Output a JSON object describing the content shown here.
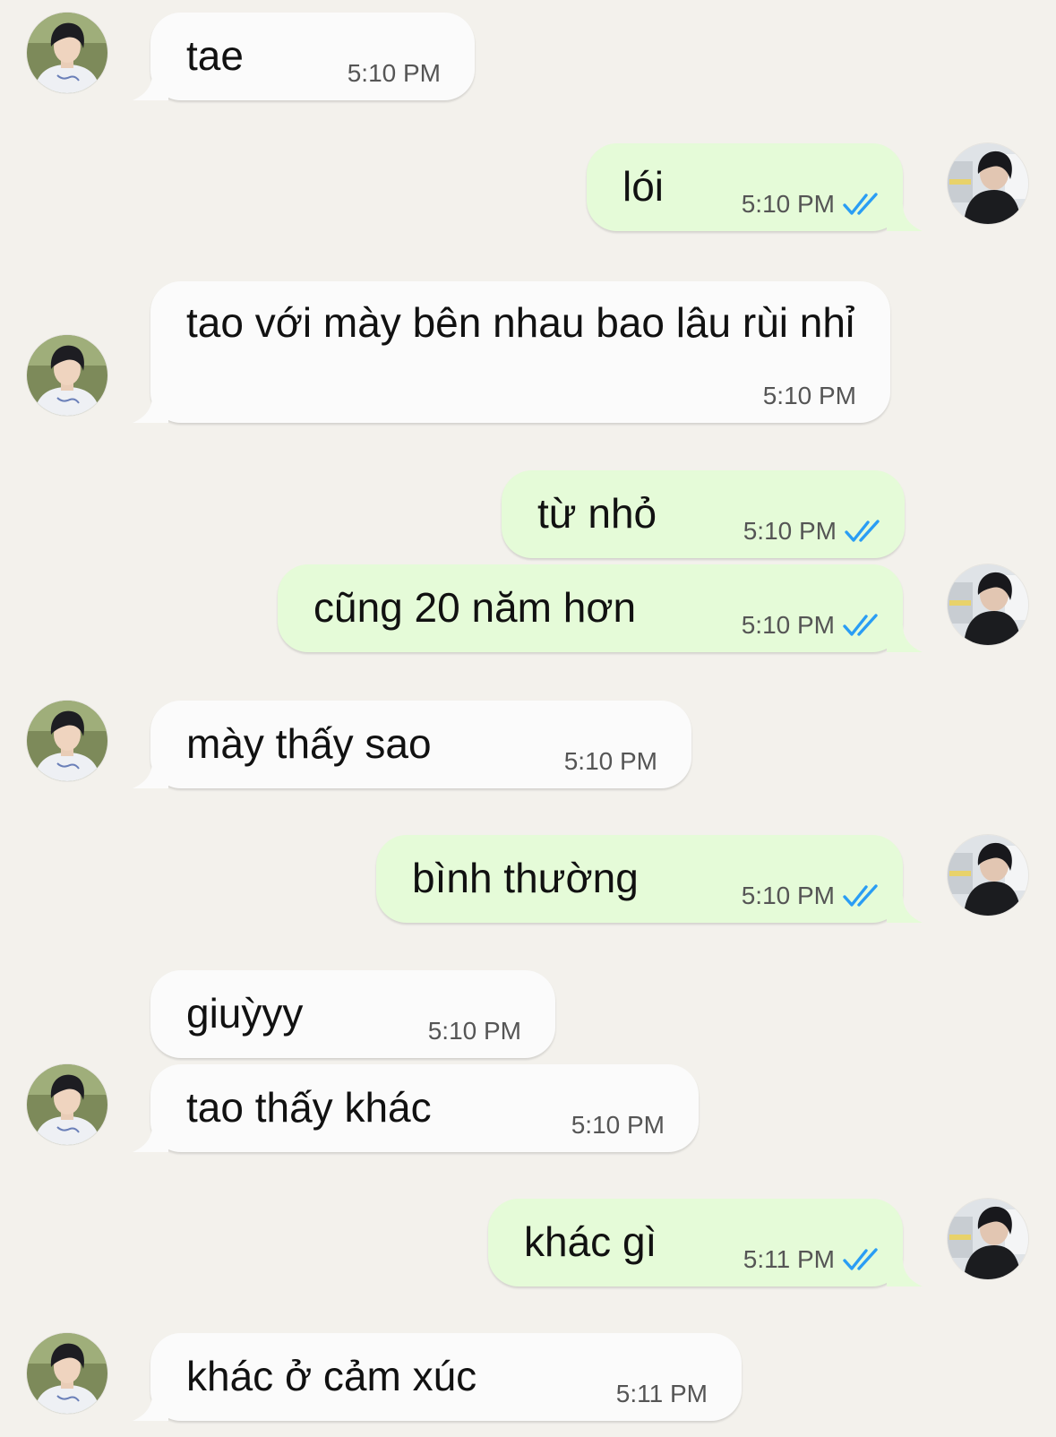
{
  "colors": {
    "background": "#f3f1ec",
    "incoming_bubble": "#fbfbfb",
    "outgoing_bubble": "#e5fbd8",
    "read_check": "#2a9df4"
  },
  "messages": [
    {
      "sender": "them",
      "text": "tae",
      "time": "5:10 PM"
    },
    {
      "sender": "me",
      "text": "lói",
      "time": "5:10 PM",
      "status": "read"
    },
    {
      "sender": "them",
      "text": "tao với mày bên nhau bao lâu rùi nhỉ",
      "time": "5:10 PM"
    },
    {
      "sender": "me",
      "text": "từ nhỏ",
      "time": "5:10 PM",
      "status": "read"
    },
    {
      "sender": "me",
      "text": "cũng 20 năm hơn",
      "time": "5:10 PM",
      "status": "read"
    },
    {
      "sender": "them",
      "text": "mày thấy sao",
      "time": "5:10 PM"
    },
    {
      "sender": "me",
      "text": "bình thường",
      "time": "5:10 PM",
      "status": "read"
    },
    {
      "sender": "them",
      "text": "giuỳyy",
      "time": "5:10 PM"
    },
    {
      "sender": "them",
      "text": "tao thấy khác",
      "time": "5:10 PM"
    },
    {
      "sender": "me",
      "text": "khác gì",
      "time": "5:11 PM",
      "status": "read"
    },
    {
      "sender": "them",
      "text": "khác ở cảm xúc",
      "time": "5:11 PM"
    }
  ]
}
